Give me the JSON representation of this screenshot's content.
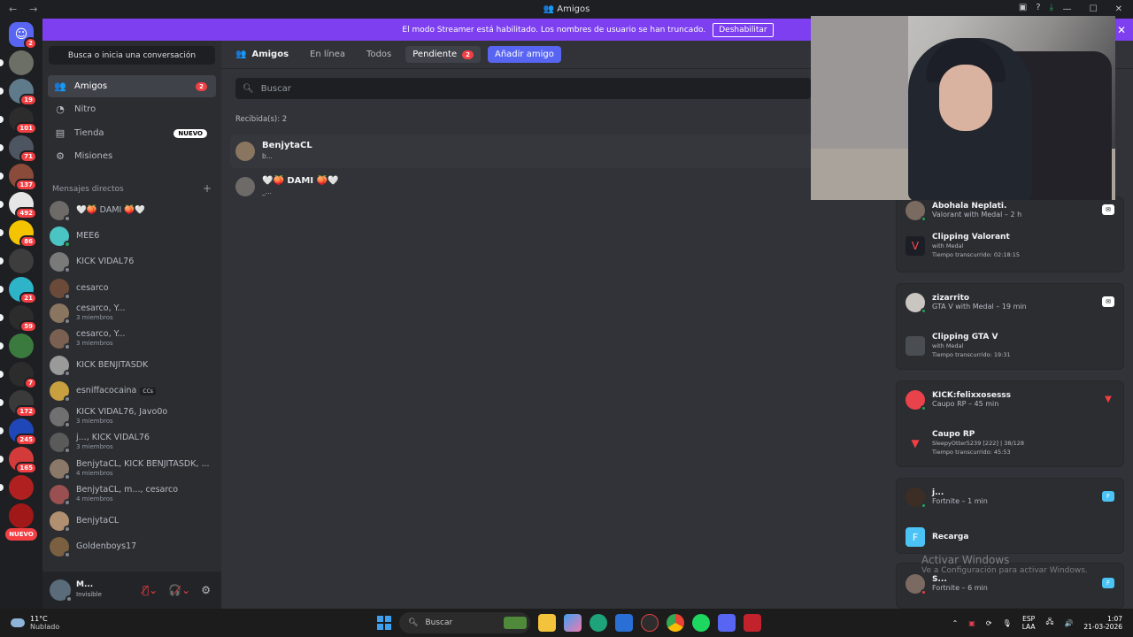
{
  "window": {
    "title": "Amigos"
  },
  "banner": {
    "text": "El modo Streamer está habilitado. Los nombres de usuario se han truncado.",
    "button": "Deshabilitar"
  },
  "servers": [
    {
      "badge": "2"
    },
    {
      "badge": ""
    },
    {
      "badge": "19"
    },
    {
      "badge": "101"
    },
    {
      "badge": "71"
    },
    {
      "badge": "137"
    },
    {
      "badge": "492"
    },
    {
      "badge": "86"
    },
    {
      "badge": ""
    },
    {
      "badge": "21"
    },
    {
      "badge": "59"
    },
    {
      "badge": ""
    },
    {
      "badge": "7"
    },
    {
      "badge": "172"
    },
    {
      "badge": "245"
    },
    {
      "badge": "165"
    },
    {
      "badge": ""
    },
    {
      "badge": ""
    }
  ],
  "servers_new_label": "NUEVO",
  "sidebar": {
    "search_label": "Busca o inicia una conversación",
    "nav": [
      {
        "label": "Amigos",
        "badge": "2"
      },
      {
        "label": "Nitro"
      },
      {
        "label": "Tienda",
        "tag": "NUEVO"
      },
      {
        "label": "Misiones"
      }
    ],
    "dm_header": "Mensajes directos",
    "dm_add": "+",
    "dms": [
      {
        "name": "🤍🍑 DAMI 🍑🤍",
        "sub": ""
      },
      {
        "name": "MEE6",
        "sub": ""
      },
      {
        "name": "KICK VIDAL76",
        "sub": ""
      },
      {
        "name": "cesarco",
        "sub": ""
      },
      {
        "name": "cesarco, Y...",
        "sub": "3 miembros"
      },
      {
        "name": "cesarco, Y...",
        "sub": "3 miembros"
      },
      {
        "name": "KICK BENJITASDK",
        "sub": ""
      },
      {
        "name": "esniffacocaina",
        "sub": "",
        "tag": "CCs"
      },
      {
        "name": "KICK VIDAL76, Javo0o",
        "sub": "3 miembros"
      },
      {
        "name": "j..., KICK VIDAL76",
        "sub": "3 miembros"
      },
      {
        "name": "BenjytaCL, KICK BENJITASDK, ...",
        "sub": "4 miembros"
      },
      {
        "name": "BenjytaCL, m..., cesarco",
        "sub": "4 miembros"
      },
      {
        "name": "BenjytaCL",
        "sub": ""
      },
      {
        "name": "Goldenboys17",
        "sub": ""
      }
    ]
  },
  "user": {
    "name": "M...",
    "status": "Invisible"
  },
  "topbar": {
    "title": "Amigos",
    "tabs": [
      "En línea",
      "Todos",
      "Pendiente"
    ],
    "pending_badge": "2",
    "add_friend": "Añadir amigo"
  },
  "search": {
    "placeholder": "Buscar"
  },
  "received_label": "Recibida(s): 2",
  "requests": [
    {
      "name": "BenjytaCL",
      "sub": "b..."
    },
    {
      "name": "🤍🍑 DAMI 🍑🤍",
      "sub": "_..."
    }
  ],
  "activity": [
    {
      "name": "Abohala Neplati.",
      "line": "Valorant with Medal – 2 h",
      "sub_title": "Clipping Valorant",
      "sub_line1": "with Medal",
      "sub_line2": "Tiempo transcurrido: 02:18:15"
    },
    {
      "name": "zizarrito",
      "line": "GTA V with Medal – 19 min",
      "sub_title": "Clipping GTA V",
      "sub_line1": "with Medal",
      "sub_line2": "Tiempo transcurrido: 19:31"
    },
    {
      "name": "KICK:felixxosesss",
      "line": "Caupo RP – 45 min",
      "sub_title": "Caupo RP",
      "sub_line1": "SleepyOtter5239 [222] | 38/128",
      "sub_line2": "Tiempo transcurrido: 45:53"
    },
    {
      "name": "j...",
      "line": "Fortnite – 1 min",
      "sub_title": "Recarga",
      "sub_line1": "",
      "sub_line2": ""
    },
    {
      "name": "S...",
      "line": "Fortnite – 6 min"
    }
  ],
  "watermark": {
    "title": "Activar Windows",
    "sub": "Ve a Configuración para activar Windows."
  },
  "taskbar": {
    "weather_temp": "11°C",
    "weather_desc": "Nublado",
    "search": "Buscar",
    "lang1": "ESP",
    "lang2": "LAA",
    "time": "1:07",
    "date": "21-03-2026"
  }
}
